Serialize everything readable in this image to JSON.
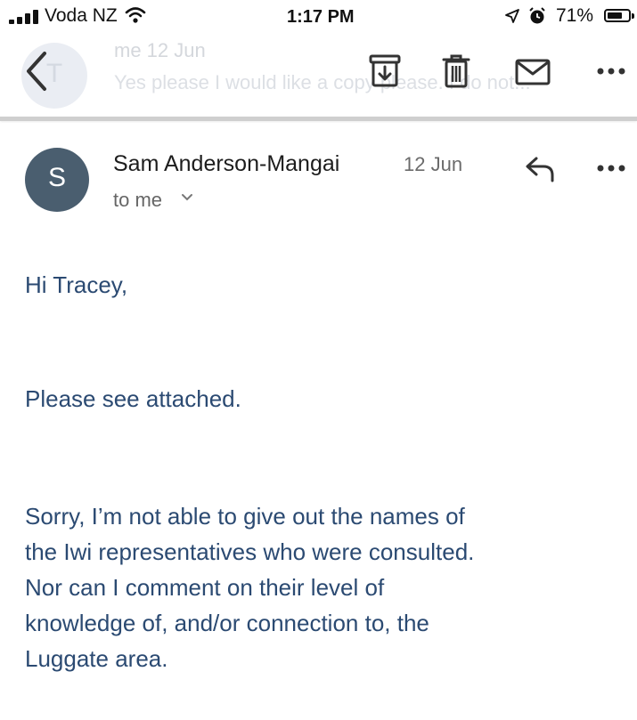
{
  "status_bar": {
    "carrier": "Voda NZ",
    "time": "1:17 PM",
    "battery_percent": "71%",
    "battery_level": 0.71
  },
  "background_message": {
    "avatar_initial": "T",
    "sender": "me  12 Jun",
    "snippet": "Yes please I would like a copy please. I do not..."
  },
  "toolbar": {
    "back_icon": "chevron-left-icon",
    "archive_icon": "archive-icon",
    "delete_icon": "trash-icon",
    "mark_unread_icon": "envelope-icon",
    "more_icon": "more-horizontal-icon"
  },
  "email": {
    "avatar_initial": "S",
    "avatar_color": "#4a5e6f",
    "sender": "Sam Anderson-Mangai",
    "date": "12 Jun",
    "recipient": "to me",
    "greeting": "Hi Tracey,",
    "line1": "Please see attached.",
    "para": [
      "Sorry, I’m not able to give out the names of",
      "the Iwi representatives who were consulted.",
      "Nor can I comment on their level of",
      "knowledge of, and/or connection to, the",
      "Luggate area."
    ]
  },
  "colors": {
    "body_text": "#2b4a72",
    "accent_icon": "#111111"
  }
}
